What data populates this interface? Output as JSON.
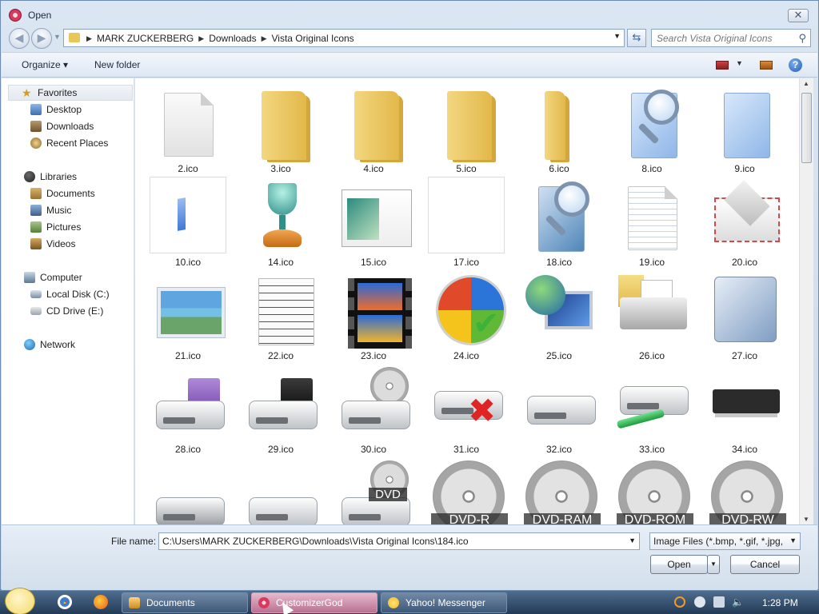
{
  "window": {
    "title": "Open",
    "close_symbol": "✕"
  },
  "address": {
    "breadcrumbs": [
      "MARK ZUCKERBERG",
      "Downloads",
      "Vista Original Icons"
    ],
    "search_placeholder": "Search Vista Original Icons"
  },
  "toolbar": {
    "organize_label": "Organize ▾",
    "new_folder_label": "New folder",
    "help_symbol": "?"
  },
  "nav": {
    "favorites": {
      "label": "Favorites",
      "items": [
        "Desktop",
        "Downloads",
        "Recent Places"
      ]
    },
    "libraries": {
      "label": "Libraries",
      "items": [
        "Documents",
        "Music",
        "Pictures",
        "Videos"
      ]
    },
    "computer": {
      "label": "Computer",
      "items": [
        "Local Disk (C:)",
        "CD Drive (E:)"
      ]
    },
    "network": {
      "label": "Network"
    }
  },
  "files": [
    {
      "name": "2.ico",
      "icon": "blank-document"
    },
    {
      "name": "3.ico",
      "icon": "folder"
    },
    {
      "name": "4.ico",
      "icon": "folder"
    },
    {
      "name": "5.ico",
      "icon": "folder"
    },
    {
      "name": "6.ico",
      "icon": "folder-thin"
    },
    {
      "name": "8.ico",
      "icon": "search-folder"
    },
    {
      "name": "9.ico",
      "icon": "blue-document"
    },
    {
      "name": "10.ico",
      "icon": "small-blue-page"
    },
    {
      "name": "14.ico",
      "icon": "trophy"
    },
    {
      "name": "15.ico",
      "icon": "window-picture"
    },
    {
      "name": "17.ico",
      "icon": "empty"
    },
    {
      "name": "18.ico",
      "icon": "search-folder"
    },
    {
      "name": "19.ico",
      "icon": "text-document"
    },
    {
      "name": "20.ico",
      "icon": "envelope"
    },
    {
      "name": "21.ico",
      "icon": "photo"
    },
    {
      "name": "22.ico",
      "icon": "sheet-music"
    },
    {
      "name": "23.ico",
      "icon": "film-strip"
    },
    {
      "name": "24.ico",
      "icon": "windows-orb-check"
    },
    {
      "name": "25.ico",
      "icon": "globe-monitor"
    },
    {
      "name": "26.ico",
      "icon": "printer"
    },
    {
      "name": "27.ico",
      "icon": "phone"
    },
    {
      "name": "28.ico",
      "icon": "floppy-drive"
    },
    {
      "name": "29.ico",
      "icon": "floppy-drive-black"
    },
    {
      "name": "30.ico",
      "icon": "cd-drive"
    },
    {
      "name": "31.ico",
      "icon": "drive-error"
    },
    {
      "name": "32.ico",
      "icon": "drive"
    },
    {
      "name": "33.ico",
      "icon": "network-drive"
    },
    {
      "name": "34.ico",
      "icon": "memory-chip"
    },
    {
      "name": "",
      "icon": "drive-dark"
    },
    {
      "name": "",
      "icon": "drive-windows"
    },
    {
      "name": "",
      "icon": "dvd-drive",
      "label": "DVD"
    },
    {
      "name": "",
      "icon": "disc",
      "label": "DVD-R"
    },
    {
      "name": "",
      "icon": "disc",
      "label": "DVD-RAM"
    },
    {
      "name": "",
      "icon": "disc",
      "label": "DVD-ROM"
    },
    {
      "name": "",
      "icon": "disc",
      "label": "DVD-RW"
    }
  ],
  "bottom": {
    "file_name_label": "File name:",
    "file_name_value": "C:\\Users\\MARK ZUCKERBERG\\Downloads\\Vista Original Icons\\184.ico",
    "file_type_value": "Image Files (*.bmp, *.gif, *.jpg,",
    "open_label": "Open",
    "cancel_label": "Cancel"
  },
  "taskbar": {
    "tasks": [
      "Documents",
      "CustomizerGod",
      "Yahoo! Messenger"
    ],
    "active_task": "CustomizerGod",
    "clock": "1:28 PM"
  },
  "colors": {
    "window_bg": "#dbe6f3",
    "taskbar_bg": "#233a55",
    "folder": "#f3d780"
  }
}
